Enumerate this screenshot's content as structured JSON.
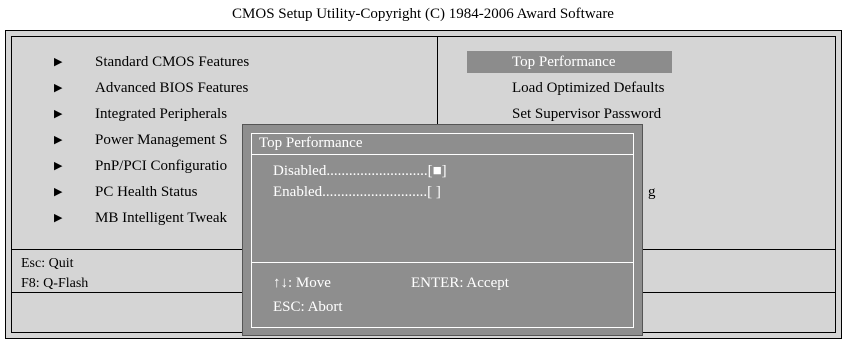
{
  "header": {
    "title": "CMOS Setup Utility-Copyright (C) 1984-2006 Award Software"
  },
  "left_menu": {
    "arrow_glyph": "▶",
    "items": [
      "Standard CMOS Features",
      "Advanced BIOS Features",
      "Integrated Peripherals",
      "Power Management S",
      "PnP/PCI Configuratio",
      "PC Health Status",
      "MB Intelligent Tweak"
    ]
  },
  "right_menu": {
    "items": [
      "Top Performance",
      "Load Optimized Defaults",
      "Set Supervisor Password",
      "g"
    ],
    "selected": "Top Performance",
    "highlight_color": "#8c8c8c"
  },
  "footer": {
    "esc": "Esc: Quit",
    "f8": "F8: Q-Flash"
  },
  "popup": {
    "title": "Top Performance",
    "options": [
      {
        "label": "Disabled",
        "value": "[■]",
        "selected": true
      },
      {
        "label": "Enabled",
        "value": "[ ]",
        "selected": false
      }
    ],
    "help_move": "↑↓: Move",
    "help_accept": "ENTER: Accept",
    "help_abort": "ESC: Abort",
    "background_color": "#8e8e8e"
  }
}
